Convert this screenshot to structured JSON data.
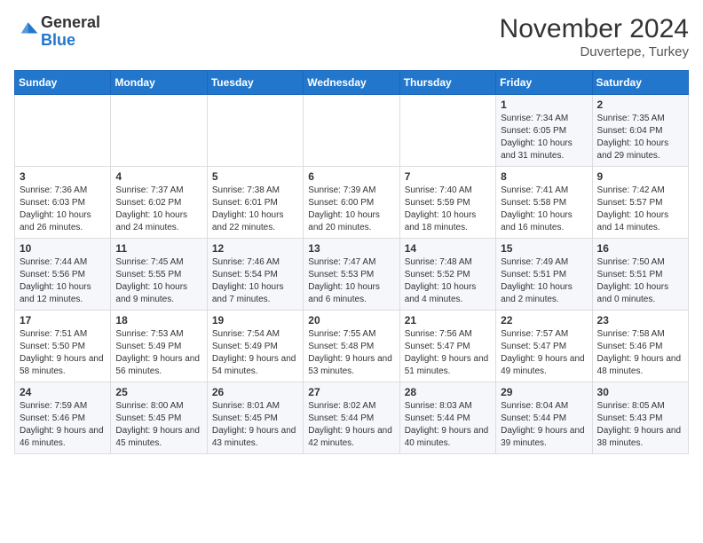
{
  "logo": {
    "general": "General",
    "blue": "Blue"
  },
  "title": {
    "month": "November 2024",
    "location": "Duvertepe, Turkey"
  },
  "headers": [
    "Sunday",
    "Monday",
    "Tuesday",
    "Wednesday",
    "Thursday",
    "Friday",
    "Saturday"
  ],
  "weeks": [
    [
      {
        "day": "",
        "info": ""
      },
      {
        "day": "",
        "info": ""
      },
      {
        "day": "",
        "info": ""
      },
      {
        "day": "",
        "info": ""
      },
      {
        "day": "",
        "info": ""
      },
      {
        "day": "1",
        "info": "Sunrise: 7:34 AM\nSunset: 6:05 PM\nDaylight: 10 hours and 31 minutes."
      },
      {
        "day": "2",
        "info": "Sunrise: 7:35 AM\nSunset: 6:04 PM\nDaylight: 10 hours and 29 minutes."
      }
    ],
    [
      {
        "day": "3",
        "info": "Sunrise: 7:36 AM\nSunset: 6:03 PM\nDaylight: 10 hours and 26 minutes."
      },
      {
        "day": "4",
        "info": "Sunrise: 7:37 AM\nSunset: 6:02 PM\nDaylight: 10 hours and 24 minutes."
      },
      {
        "day": "5",
        "info": "Sunrise: 7:38 AM\nSunset: 6:01 PM\nDaylight: 10 hours and 22 minutes."
      },
      {
        "day": "6",
        "info": "Sunrise: 7:39 AM\nSunset: 6:00 PM\nDaylight: 10 hours and 20 minutes."
      },
      {
        "day": "7",
        "info": "Sunrise: 7:40 AM\nSunset: 5:59 PM\nDaylight: 10 hours and 18 minutes."
      },
      {
        "day": "8",
        "info": "Sunrise: 7:41 AM\nSunset: 5:58 PM\nDaylight: 10 hours and 16 minutes."
      },
      {
        "day": "9",
        "info": "Sunrise: 7:42 AM\nSunset: 5:57 PM\nDaylight: 10 hours and 14 minutes."
      }
    ],
    [
      {
        "day": "10",
        "info": "Sunrise: 7:44 AM\nSunset: 5:56 PM\nDaylight: 10 hours and 12 minutes."
      },
      {
        "day": "11",
        "info": "Sunrise: 7:45 AM\nSunset: 5:55 PM\nDaylight: 10 hours and 9 minutes."
      },
      {
        "day": "12",
        "info": "Sunrise: 7:46 AM\nSunset: 5:54 PM\nDaylight: 10 hours and 7 minutes."
      },
      {
        "day": "13",
        "info": "Sunrise: 7:47 AM\nSunset: 5:53 PM\nDaylight: 10 hours and 6 minutes."
      },
      {
        "day": "14",
        "info": "Sunrise: 7:48 AM\nSunset: 5:52 PM\nDaylight: 10 hours and 4 minutes."
      },
      {
        "day": "15",
        "info": "Sunrise: 7:49 AM\nSunset: 5:51 PM\nDaylight: 10 hours and 2 minutes."
      },
      {
        "day": "16",
        "info": "Sunrise: 7:50 AM\nSunset: 5:51 PM\nDaylight: 10 hours and 0 minutes."
      }
    ],
    [
      {
        "day": "17",
        "info": "Sunrise: 7:51 AM\nSunset: 5:50 PM\nDaylight: 9 hours and 58 minutes."
      },
      {
        "day": "18",
        "info": "Sunrise: 7:53 AM\nSunset: 5:49 PM\nDaylight: 9 hours and 56 minutes."
      },
      {
        "day": "19",
        "info": "Sunrise: 7:54 AM\nSunset: 5:49 PM\nDaylight: 9 hours and 54 minutes."
      },
      {
        "day": "20",
        "info": "Sunrise: 7:55 AM\nSunset: 5:48 PM\nDaylight: 9 hours and 53 minutes."
      },
      {
        "day": "21",
        "info": "Sunrise: 7:56 AM\nSunset: 5:47 PM\nDaylight: 9 hours and 51 minutes."
      },
      {
        "day": "22",
        "info": "Sunrise: 7:57 AM\nSunset: 5:47 PM\nDaylight: 9 hours and 49 minutes."
      },
      {
        "day": "23",
        "info": "Sunrise: 7:58 AM\nSunset: 5:46 PM\nDaylight: 9 hours and 48 minutes."
      }
    ],
    [
      {
        "day": "24",
        "info": "Sunrise: 7:59 AM\nSunset: 5:46 PM\nDaylight: 9 hours and 46 minutes."
      },
      {
        "day": "25",
        "info": "Sunrise: 8:00 AM\nSunset: 5:45 PM\nDaylight: 9 hours and 45 minutes."
      },
      {
        "day": "26",
        "info": "Sunrise: 8:01 AM\nSunset: 5:45 PM\nDaylight: 9 hours and 43 minutes."
      },
      {
        "day": "27",
        "info": "Sunrise: 8:02 AM\nSunset: 5:44 PM\nDaylight: 9 hours and 42 minutes."
      },
      {
        "day": "28",
        "info": "Sunrise: 8:03 AM\nSunset: 5:44 PM\nDaylight: 9 hours and 40 minutes."
      },
      {
        "day": "29",
        "info": "Sunrise: 8:04 AM\nSunset: 5:44 PM\nDaylight: 9 hours and 39 minutes."
      },
      {
        "day": "30",
        "info": "Sunrise: 8:05 AM\nSunset: 5:43 PM\nDaylight: 9 hours and 38 minutes."
      }
    ]
  ]
}
